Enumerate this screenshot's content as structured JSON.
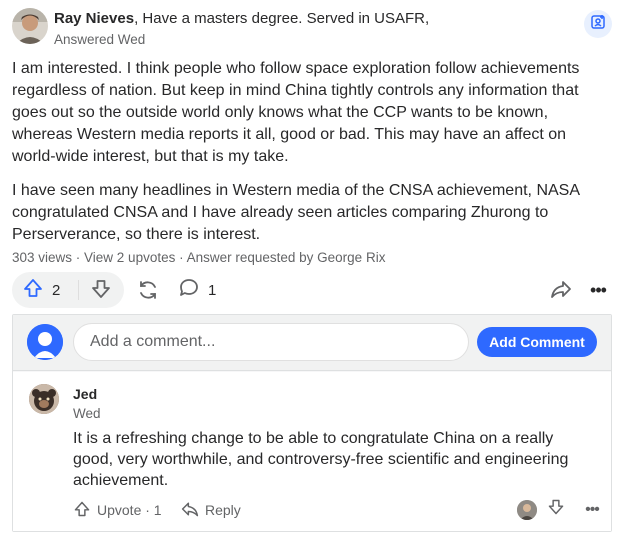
{
  "answer": {
    "author_name": "Ray Nieves",
    "author_credential": ", Have a masters degree. Served in USAFR,",
    "answered": "Answered Wed",
    "paragraphs": [
      "I am interested. I think people who follow space exploration follow achievements regardless of nation. But keep in mind China tightly controls any information that goes out so the outside world only knows what the CCP wants to be known, whereas Western media reports it all, good or bad. This may have an affect on world-wide interest, but that is my take.",
      "I have seen many headlines in Western media of the CNSA achievement, NASA congratulated CNSA and I have already seen articles comparing Zhurong to Perserverance, so there is interest."
    ],
    "stats": "303 views · View 2 upvotes · Answer requested by George Rix",
    "upvote_count": "2",
    "comment_count": "1"
  },
  "comment_form": {
    "placeholder": "Add a comment...",
    "submit_label": "Add Comment"
  },
  "comment": {
    "author": "Jed",
    "date": "Wed",
    "text": "It is a refreshing change to be able to congratulate China on a really good, very worthwhile, and controversy-free scientific and engineering achievement.",
    "upvote_label": "Upvote · 1",
    "reply_label": "Reply"
  },
  "icons": {
    "save": "bookmark-person-icon",
    "upvote": "arrow-up-icon",
    "downvote": "arrow-down-icon",
    "reshare": "reshare-icon",
    "comment": "speech-bubble-icon",
    "share": "share-arrow-icon",
    "more": "more-icon",
    "reply": "reply-arrow-icon"
  },
  "colors": {
    "accent": "#2e69ff",
    "text": "#282829",
    "muted": "#636466"
  }
}
